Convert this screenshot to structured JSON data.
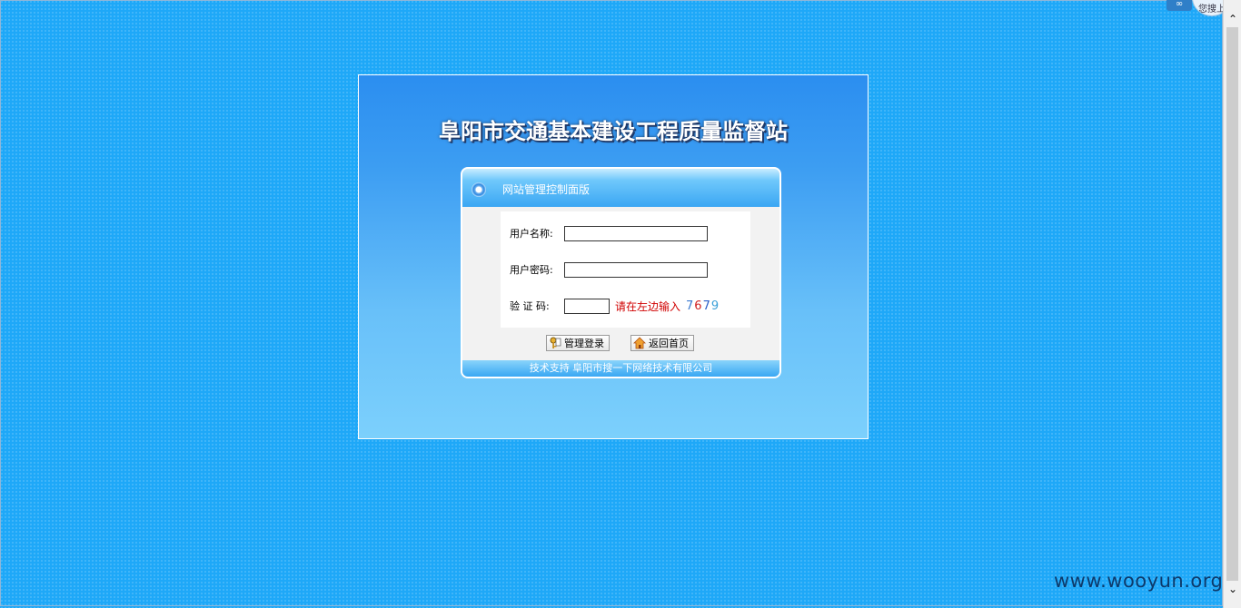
{
  "header": {
    "site_title": "阜阳市交通基本建设工程质量监督站"
  },
  "login": {
    "panel_title": "网站管理控制面版",
    "username_label": "用户名称:",
    "password_label": "用户密码:",
    "captcha_label": "验 证 码:",
    "username_value": "",
    "password_value": "",
    "captcha_value": "",
    "captcha_hint": "请在左边输入",
    "captcha_code": [
      "7",
      "6",
      "7",
      "9"
    ],
    "login_button": "管理登录",
    "home_button": "返回首页",
    "footer": "技术支持 阜阳市搜一下网络技术有限公司"
  },
  "top_widget": {
    "search_label": "您搜上"
  },
  "watermark": "www.wooyun.org",
  "colors": {
    "background": "#1ea8f8",
    "hint_red": "#d00000"
  }
}
